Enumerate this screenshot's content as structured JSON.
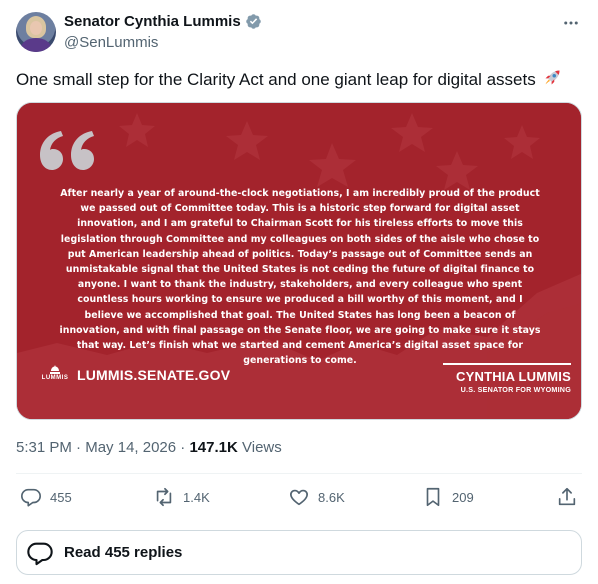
{
  "author": {
    "display_name": "Senator Cynthia Lummis",
    "handle": "@SenLummis",
    "avatar_icon": "profile-photo",
    "verified_icon": "verified-badge-icon"
  },
  "tweet": {
    "text": "One small step for the Clarity Act and one giant leap for digital assets",
    "emoji_icon": "rocket-icon"
  },
  "media": {
    "statement": "After nearly a year of around-the-clock negotiations, I am incredibly proud of the product we passed out of Committee today. This is a historic step forward for digital asset innovation, and I am grateful to Chairman Scott for his tireless efforts to move this legislation through Committee and my colleagues on both sides of the aisle who chose to put American leadership ahead of politics. Today’s passage out of Committee sends an unmistakable signal that the United States is not ceding the future of digital finance to anyone. I want to thank the industry, stakeholders, and every colleague who spent countless hours working to ensure we produced a bill worthy of this moment, and I believe we accomplished that goal. The United States has long been a beacon of innovation, and with final passage on the Senate floor, we are going to make sure it stays that way. Let’s finish what we started and cement America’s digital asset space for generations to come.",
    "logo_text": "LUMMIS",
    "website": "LUMMIS.SENATE.GOV",
    "signature_name": "CYNTHIA LUMMIS",
    "signature_title": "U.S. SENATOR FOR WYOMING",
    "background_color": "#a3232c"
  },
  "meta": {
    "time": "5:31 PM",
    "separator": "·",
    "date": "May 14, 2026",
    "views_count": "147.1K",
    "views_label": "Views"
  },
  "actions": {
    "replies": "455",
    "reposts": "1.4K",
    "likes": "8.6K",
    "bookmarks": "209"
  },
  "read_replies": {
    "label": "Read 455 replies"
  },
  "colors": {
    "text_primary": "#0f1419",
    "text_secondary": "#536471",
    "verified_blue": "#1d9bf0",
    "border": "#cfd9de"
  }
}
